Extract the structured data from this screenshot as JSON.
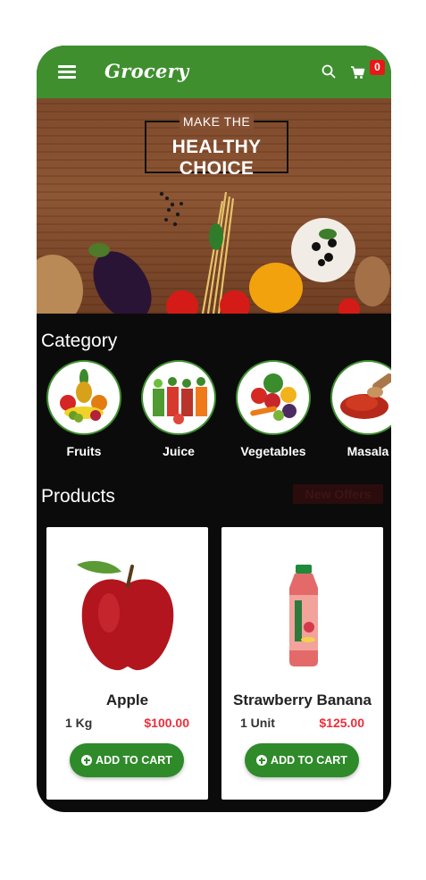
{
  "app": {
    "logo": "Grocery",
    "cart_count": "0"
  },
  "icons": {
    "menu": "hamburger-menu-icon",
    "search": "search-icon",
    "cart": "shopping-cart-icon"
  },
  "banner": {
    "line1": "MAKE THE",
    "line2": "HEALTHY CHOICE"
  },
  "category": {
    "title": "Category",
    "items": [
      {
        "label": "Fruits"
      },
      {
        "label": "Juice"
      },
      {
        "label": "Vegetables"
      },
      {
        "label": "Masala"
      }
    ]
  },
  "products": {
    "title": "Products",
    "offers_label": "New Offers",
    "items": [
      {
        "name": "Apple",
        "unit": "1 Kg",
        "price": "$100.00",
        "button": "ADD TO CART"
      },
      {
        "name": "Strawberry Banana",
        "unit": "1 Unit",
        "price": "$125.00",
        "button": "ADD TO CART"
      }
    ]
  },
  "colors": {
    "brand_green": "#3f8f2f",
    "button_green": "#2f8a2a",
    "price_red": "#ea2f3b",
    "badge_red": "#e81818",
    "background": "#0b0b0c"
  }
}
